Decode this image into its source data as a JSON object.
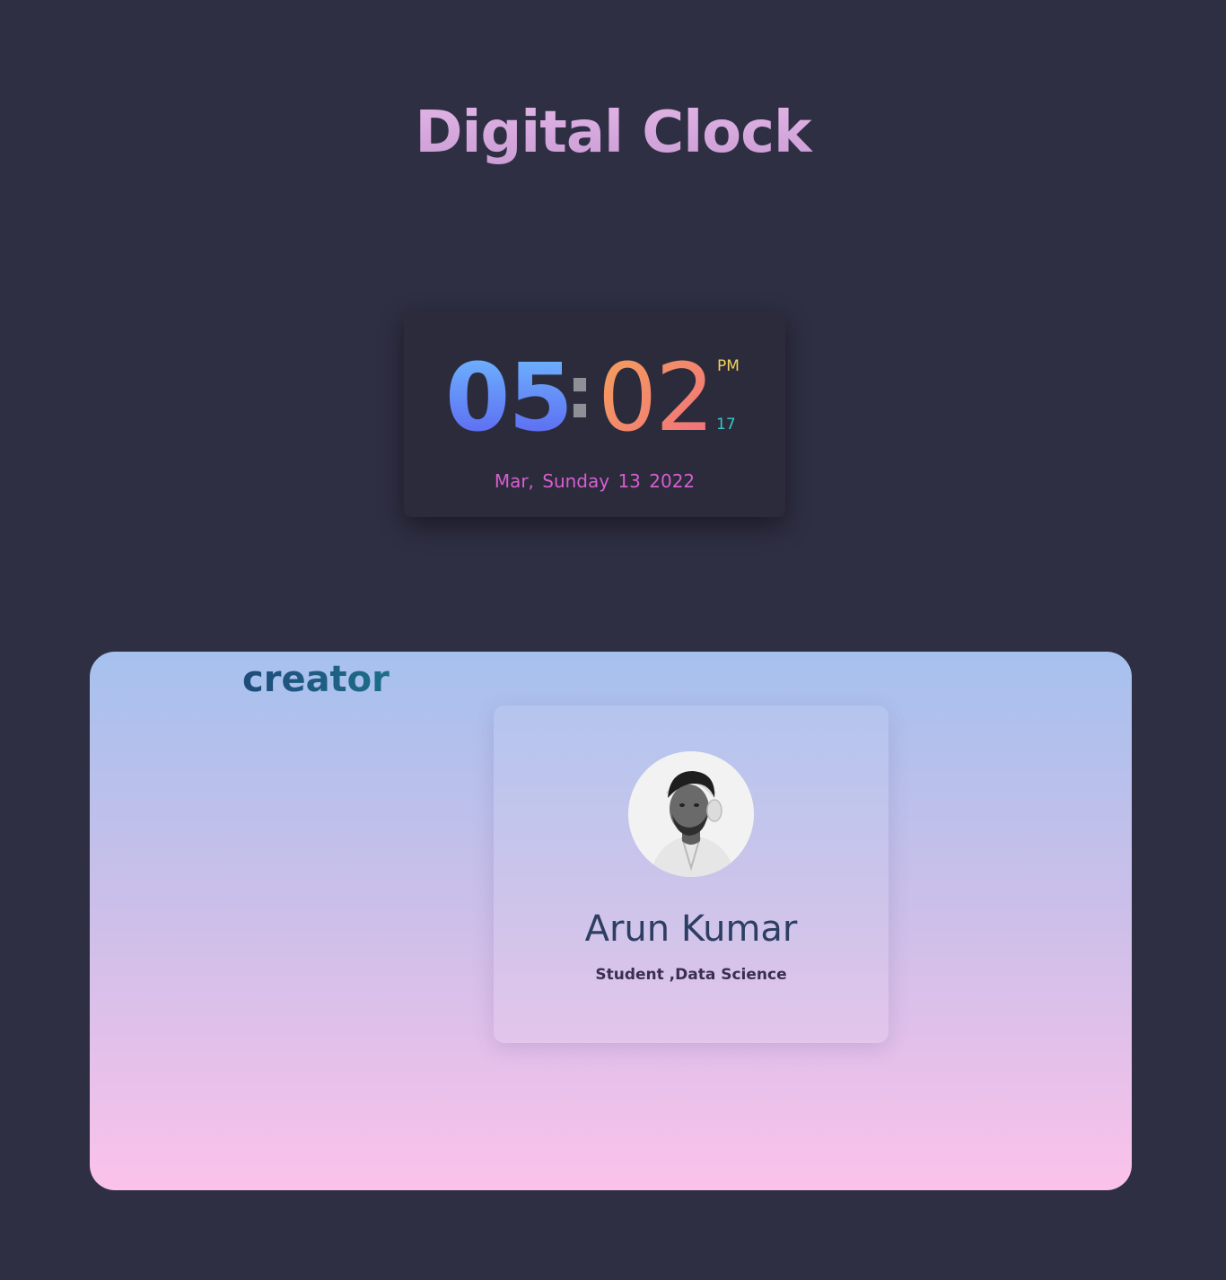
{
  "page": {
    "title": "Digital Clock"
  },
  "clock": {
    "hours": "05",
    "separator": ":",
    "minutes": "02",
    "ampm": "PM",
    "seconds": "17",
    "date": "Mar, Sunday 13 2022"
  },
  "creator": {
    "heading": "creator",
    "name": "Arun Kumar",
    "role": "Student ,Data Science",
    "avatar_icon": "person-photo-icon"
  },
  "colors": {
    "background": "#2f2f44",
    "title": "#d6a8dc",
    "hours_gradient": [
      "#6fb8ff",
      "#5b63f0"
    ],
    "minutes_gradient": [
      "#f4a25a",
      "#f26e7e"
    ],
    "ampm": "#f2d15c",
    "seconds": "#39c7c6",
    "date": "#d65fd0",
    "panel_gradient": [
      "#a6c1ee",
      "#fbc2eb"
    ],
    "name": "#2d3e63"
  }
}
